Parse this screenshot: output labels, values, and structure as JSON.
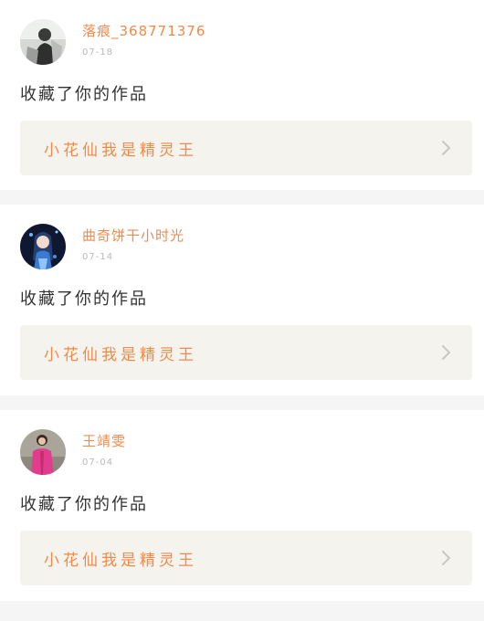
{
  "notifications": [
    {
      "username": "落痕_368771376",
      "date": "07-18",
      "action": "收藏了你的作品",
      "work_title": "小花仙我是精灵王",
      "avatar_icon": "avatar-grayscale-icon"
    },
    {
      "username": "曲奇饼干小时光",
      "date": "07-14",
      "action": "收藏了你的作品",
      "work_title": "小花仙我是精灵王",
      "avatar_icon": "avatar-anime-girl-icon"
    },
    {
      "username": "王靖雯",
      "date": "07-04",
      "action": "收藏了你的作品",
      "work_title": "小花仙我是精灵王",
      "avatar_icon": "avatar-pink-jacket-icon"
    }
  ],
  "colors": {
    "accent": "#f08a4b",
    "link_bg": "#f4f3ee",
    "divider": "#f5f5f5",
    "text": "#333333",
    "date": "#b8b8b8"
  }
}
